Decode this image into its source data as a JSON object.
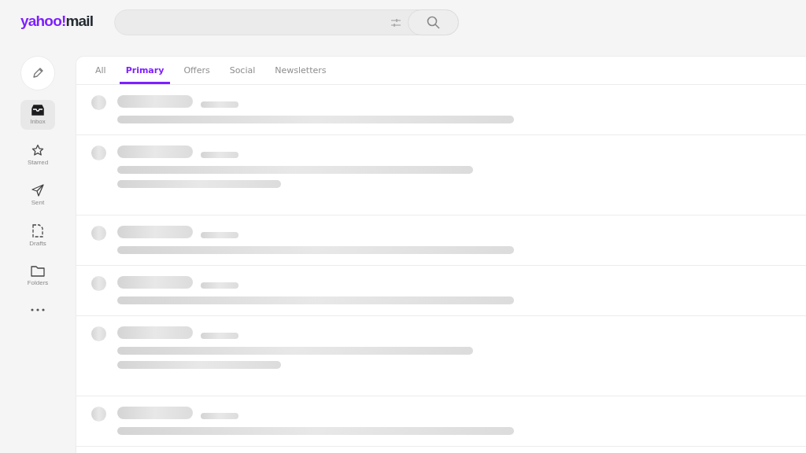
{
  "logo": {
    "brand": "yahoo!",
    "product": "mail"
  },
  "sidebar": {
    "items": [
      {
        "label": "Inbox",
        "kind": "inbox",
        "selected": true
      },
      {
        "label": "Starred",
        "kind": "star",
        "selected": false
      },
      {
        "label": "Sent",
        "kind": "sent",
        "selected": false
      },
      {
        "label": "Drafts",
        "kind": "drafts",
        "selected": false
      },
      {
        "label": "Folders",
        "kind": "folder",
        "selected": false
      }
    ]
  },
  "tabs": [
    {
      "label": "All",
      "selected": false
    },
    {
      "label": "Primary",
      "selected": true
    },
    {
      "label": "Offers",
      "selected": false
    },
    {
      "label": "Social",
      "selected": false
    },
    {
      "label": "Newsletters",
      "selected": false
    }
  ],
  "message_list": {
    "rows": [
      {
        "kind": "one-line"
      },
      {
        "kind": "two-line"
      },
      {
        "kind": "one-line"
      },
      {
        "kind": "one-line"
      },
      {
        "kind": "two-line"
      },
      {
        "kind": "one-line"
      }
    ]
  }
}
